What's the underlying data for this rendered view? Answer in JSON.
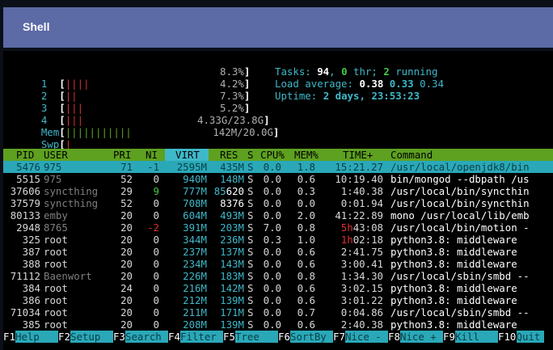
{
  "window": {
    "title": "Shell"
  },
  "meters": {
    "cpus": [
      {
        "label": "1",
        "bar": "||||",
        "bar_class": "bar-r",
        "value": "8.3%"
      },
      {
        "label": "2",
        "bar": "||",
        "bar_class": "bar-r",
        "value": "4.2%"
      },
      {
        "label": "3",
        "bar": "|||",
        "bar_class": "bar-r",
        "value": "7.3%"
      },
      {
        "label": "4",
        "bar": "|||",
        "bar_class": "bar-r",
        "value": "5.2%"
      }
    ],
    "mem": {
      "label": "Mem",
      "bar": "|||||||||||",
      "value": "4.33G/23.8G"
    },
    "swp": {
      "label": "Swp",
      "bar": "|",
      "value": "142M/20.0G"
    }
  },
  "summary": {
    "tasks_label": "Tasks: ",
    "tasks": "94",
    "thr_sep": ", ",
    "thr": "0",
    "thr_label": " thr; ",
    "running": "2",
    "running_label": " running",
    "load_label": "Load average: ",
    "load1": "0.38",
    "load5": "0.33",
    "load15": "0.34",
    "uptime_label": "Uptime: ",
    "uptime": "2 days, 23:53:23"
  },
  "table": {
    "headers": {
      "pid": "PID",
      "user": "USER",
      "pri": "PRI",
      "ni": "NI",
      "virt": "VIRT",
      "res": "RES",
      "s": "S",
      "cpu": "CPU%",
      "mem": "MEM%",
      "time": "TIME+",
      "command": "Command"
    },
    "rows": [
      {
        "pid": "5476",
        "user": "975",
        "pri": "71",
        "ni": "-1",
        "virt": "2595M",
        "res": "435M",
        "s": "S",
        "cpu": "0.0",
        "mem": "1.8",
        "time": "15:21.27",
        "command": "/usr/local/openjdk8/bin",
        "selected": true
      },
      {
        "pid": "5515",
        "user": "975",
        "pri": "52",
        "ni": "0",
        "virt": "940M",
        "res": "148M",
        "s": "S",
        "cpu": "0.0",
        "mem": "0.6",
        "time": "10:19.40",
        "command": "bin/mongod --dbpath /us"
      },
      {
        "pid": "37606",
        "user": "syncthing",
        "pri": "29",
        "ni": "9",
        "virt": "777M",
        "res": "85620",
        "s": "S",
        "cpu": "0.0",
        "mem": "0.3",
        "time": "1:40.38",
        "command": "/usr/local/bin/syncthin"
      },
      {
        "pid": "37579",
        "user": "syncthing",
        "pri": "52",
        "ni": "0",
        "virt": "708M",
        "res": "8376",
        "s": "S",
        "cpu": "0.0",
        "mem": "0.0",
        "time": "0:01.94",
        "command": "/usr/local/bin/syncthin"
      },
      {
        "pid": "80133",
        "user": "emby",
        "pri": "20",
        "ni": "0",
        "virt": "604M",
        "res": "493M",
        "s": "S",
        "cpu": "0.0",
        "mem": "2.0",
        "time": "41:22.89",
        "command": "mono /usr/local/lib/emb"
      },
      {
        "pid": "2948",
        "user": "8765",
        "pri": "20",
        "ni": "-2",
        "virt": "391M",
        "res": "203M",
        "s": "S",
        "cpu": "7.0",
        "mem": "0.8",
        "time": "5h43:08",
        "command": "/usr/local/bin/motion -"
      },
      {
        "pid": "325",
        "user": "root",
        "pri": "20",
        "ni": "0",
        "virt": "344M",
        "res": "236M",
        "s": "S",
        "cpu": "0.3",
        "mem": "1.0",
        "time": "1h02:18",
        "command": "python3.8: middleware"
      },
      {
        "pid": "387",
        "user": "root",
        "pri": "20",
        "ni": "0",
        "virt": "237M",
        "res": "137M",
        "s": "S",
        "cpu": "0.0",
        "mem": "0.6",
        "time": "2:41.75",
        "command": "python3.8: middleware"
      },
      {
        "pid": "388",
        "user": "root",
        "pri": "20",
        "ni": "0",
        "virt": "234M",
        "res": "143M",
        "s": "S",
        "cpu": "0.0",
        "mem": "0.6",
        "time": "3:00.41",
        "command": "python3.8: middleware"
      },
      {
        "pid": "71112",
        "user": "Baenwort",
        "pri": "20",
        "ni": "0",
        "virt": "226M",
        "res": "183M",
        "s": "S",
        "cpu": "0.0",
        "mem": "0.8",
        "time": "1:34.30",
        "command": "/usr/local/sbin/smbd --"
      },
      {
        "pid": "384",
        "user": "root",
        "pri": "24",
        "ni": "0",
        "virt": "216M",
        "res": "142M",
        "s": "S",
        "cpu": "0.0",
        "mem": "0.6",
        "time": "3:02.15",
        "command": "python3.8: middleware"
      },
      {
        "pid": "386",
        "user": "root",
        "pri": "20",
        "ni": "0",
        "virt": "212M",
        "res": "139M",
        "s": "S",
        "cpu": "0.0",
        "mem": "0.6",
        "time": "3:01.22",
        "command": "python3.8: middleware"
      },
      {
        "pid": "71034",
        "user": "root",
        "pri": "20",
        "ni": "0",
        "virt": "211M",
        "res": "171M",
        "s": "S",
        "cpu": "0.0",
        "mem": "0.7",
        "time": "0:04.86",
        "command": "/usr/local/sbin/smbd --"
      },
      {
        "pid": "385",
        "user": "root",
        "pri": "20",
        "ni": "0",
        "virt": "208M",
        "res": "139M",
        "s": "S",
        "cpu": "0.0",
        "mem": "0.6",
        "time": "2:40.38",
        "command": "python3.8: middleware"
      }
    ]
  },
  "footer": [
    {
      "key": "F1",
      "label": "Help"
    },
    {
      "key": "F2",
      "label": "Setup"
    },
    {
      "key": "F3",
      "label": "Search"
    },
    {
      "key": "F4",
      "label": "Filter"
    },
    {
      "key": "F5",
      "label": "Tree"
    },
    {
      "key": "F6",
      "label": "SortBy"
    },
    {
      "key": "F7",
      "label": "Nice -"
    },
    {
      "key": "F8",
      "label": "Nice +"
    },
    {
      "key": "F9",
      "label": "Kill"
    },
    {
      "key": "F10",
      "label": "Quit"
    }
  ]
}
